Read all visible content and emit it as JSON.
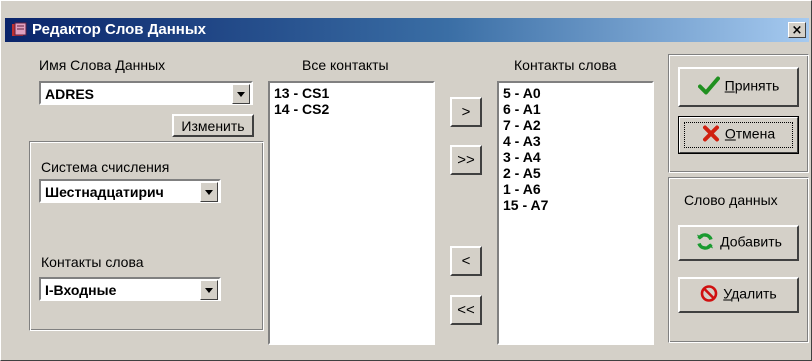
{
  "window": {
    "title": "Редактор Слов Данных",
    "close_glyph": "×"
  },
  "word_name": {
    "label": "Имя Слова Данных",
    "value": "ADRES",
    "change_button": "Изменить"
  },
  "numbering": {
    "label": "Система счисления",
    "value": "Шестнадцатирич"
  },
  "word_contacts_filter": {
    "label": "Контакты слова",
    "value": "I-Входные"
  },
  "all_contacts": {
    "label": "Все контакты",
    "items": [
      "13 - CS1",
      "14 - CS2"
    ]
  },
  "word_contacts": {
    "label": "Контакты слова",
    "items": [
      "5 - A0",
      "6 - A1",
      "7 - A2",
      "4 - A3",
      "3 - A4",
      "2 - A5",
      "1 - A6",
      "15 - A7"
    ]
  },
  "transfer": {
    "add_one": ">",
    "add_all": ">>",
    "remove_one": "<",
    "remove_all": "<<"
  },
  "actions": {
    "accept_prefix": "П",
    "accept_rest": "ринять",
    "cancel_prefix": "О",
    "cancel_rest": "тмена"
  },
  "data_word": {
    "label": "Слово данных",
    "add_prefix": "Д",
    "add_rest": "обавить",
    "delete_prefix": "У",
    "delete_rest": "далить"
  },
  "icons": {
    "app": "dictionary-icon",
    "accept": "checkmark-icon",
    "cancel": "x-icon",
    "add": "refresh-icon",
    "delete": "no-entry-icon"
  },
  "colors": {
    "titlebar_start": "#0a246a",
    "titlebar_end": "#a6caf0",
    "face": "#d4d0c8"
  }
}
